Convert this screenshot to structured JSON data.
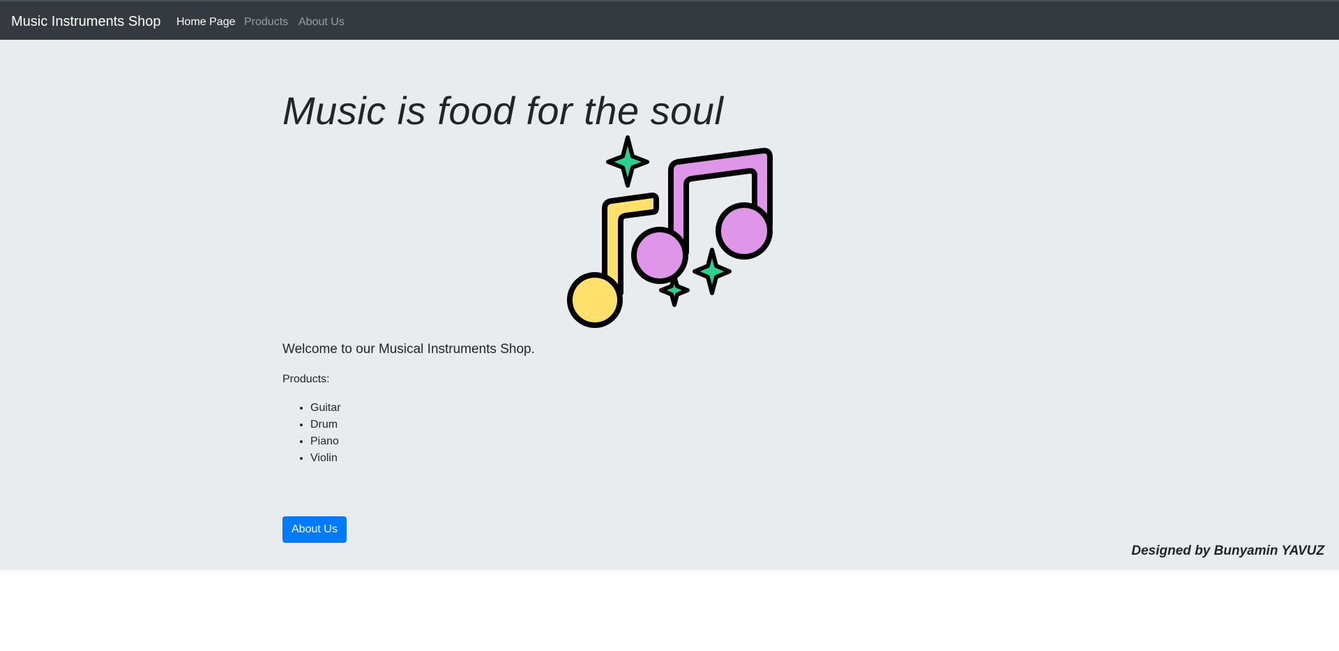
{
  "navbar": {
    "brand": "Music Instruments Shop",
    "links": [
      {
        "label": "Home Page",
        "active": true
      },
      {
        "label": "Products",
        "active": false
      },
      {
        "label": "About Us",
        "active": false
      }
    ]
  },
  "hero": {
    "headline": "Music is food for the soul",
    "image_icon": "music-notes-with-sparkles",
    "lead": "Welcome to our Musical Instruments Shop.",
    "products_label": "Products:",
    "products": [
      "Guitar",
      "Drum",
      "Piano",
      "Violin"
    ],
    "button_label": "About Us",
    "credit": "Designed by Bunyamin YAVUZ"
  },
  "colors": {
    "navbar_bg": "#343a40",
    "jumbotron_bg": "#e9ecef",
    "primary_button": "#007bff",
    "note_yellow": "#ffe06a",
    "note_pink": "#df96e8",
    "sparkle_green": "#2ed08d"
  }
}
